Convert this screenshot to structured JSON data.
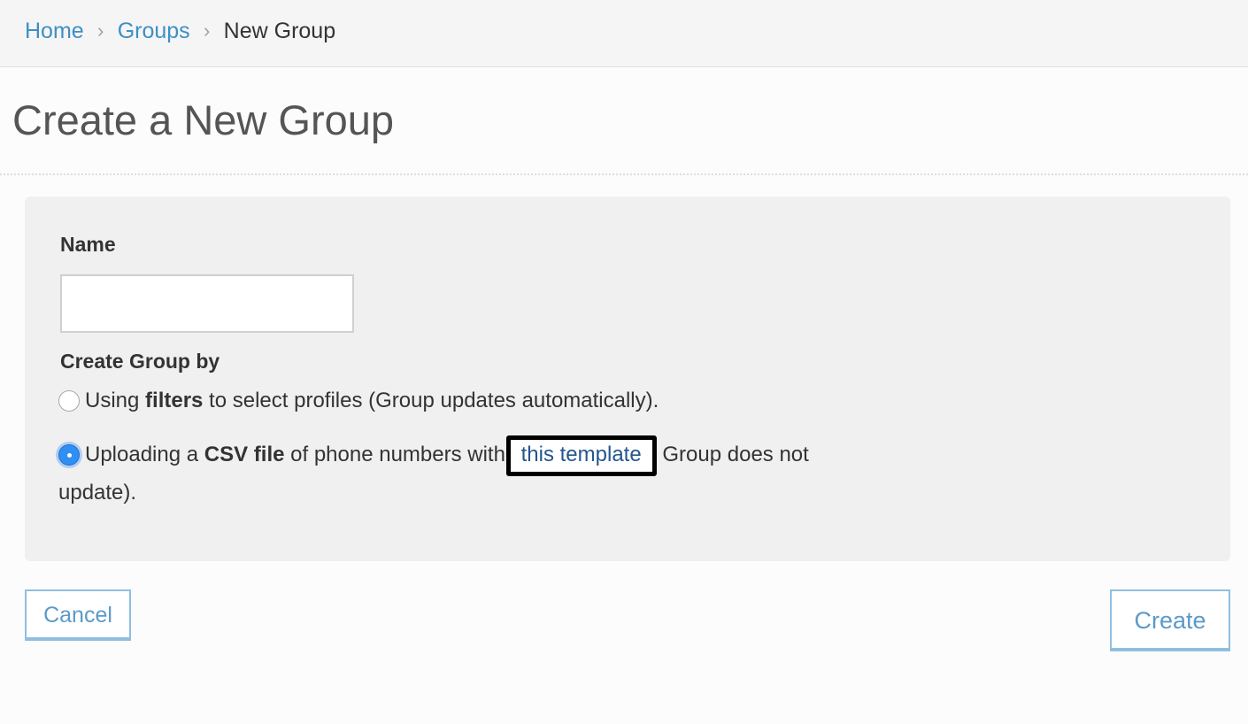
{
  "breadcrumb": {
    "home": "Home",
    "groups": "Groups",
    "current": "New Group",
    "separator": "›"
  },
  "page": {
    "title": "Create a New Group"
  },
  "form": {
    "name_label": "Name",
    "name_value": "",
    "method_label": "Create Group by",
    "option_filters": {
      "prefix": "Using ",
      "bold": "filters",
      "suffix": " to select profiles (Group updates automatically).",
      "checked": false
    },
    "option_csv": {
      "prefix": "Uploading a ",
      "bold": "CSV file",
      "middle": " of phone numbers with ",
      "link": "this template",
      "suffix": " Group does not update).",
      "checked": true
    }
  },
  "actions": {
    "cancel_label": "Cancel",
    "create_label": "Create"
  },
  "colors": {
    "link": "#3d8fc4",
    "accent_radio": "#2f8ff2",
    "button_border": "#8fbfdf"
  }
}
